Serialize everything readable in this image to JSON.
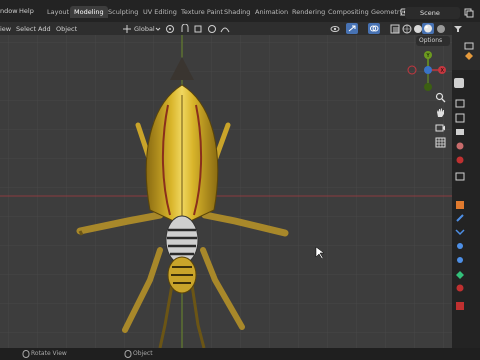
{
  "menubar": {
    "items": [
      "ndow",
      "Help"
    ],
    "workspaces": [
      {
        "label": "Layout",
        "active": false
      },
      {
        "label": "Modeling",
        "active": true
      },
      {
        "label": "Sculpting",
        "active": false
      },
      {
        "label": "UV Editing",
        "active": false
      },
      {
        "label": "Texture Paint",
        "active": false
      },
      {
        "label": "Shading",
        "active": false
      },
      {
        "label": "Animation",
        "active": false
      },
      {
        "label": "Rendering",
        "active": false
      },
      {
        "label": "Compositing",
        "active": false
      },
      {
        "label": "Geometry N",
        "active": false
      }
    ],
    "scene_label": "Scene"
  },
  "header": {
    "view": "iew",
    "select": "Select",
    "add": "Add",
    "object": "Object",
    "transform_orientation": "Global",
    "options": "Options"
  },
  "statusbar": {
    "left_hint": "Rotate View",
    "right_hint": "Object"
  },
  "colors": {
    "accent": "#4772b3",
    "axis_x": "#c5373f",
    "axis_y": "#6c9a1f",
    "axis_z": "#3a73c7"
  }
}
